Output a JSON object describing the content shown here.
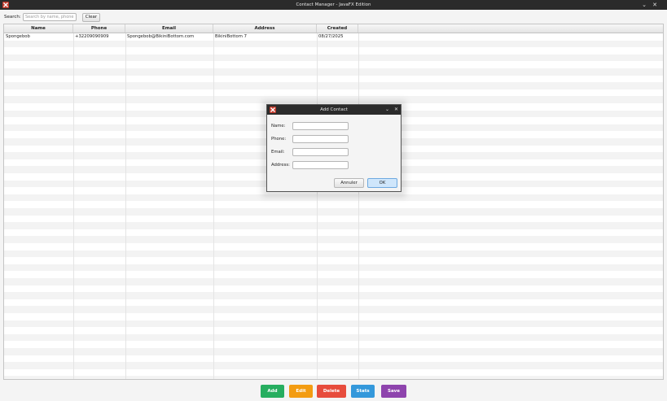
{
  "window": {
    "title": "Contact Manager - JavaFX Edition",
    "minimize_icon": "chevron-down-icon",
    "close_icon": "close-icon"
  },
  "search": {
    "label": "Search:",
    "placeholder": "Search by name, phone...",
    "value": "",
    "clear_label": "Clear"
  },
  "table": {
    "columns": [
      "Name",
      "Phone",
      "Email",
      "Address",
      "Created"
    ],
    "rows": [
      [
        "Spongebob",
        "+32209090909",
        "Spongebob@BikiniBottom.com",
        "BikiniBottom 7",
        "08/27/2025"
      ]
    ]
  },
  "actions": [
    {
      "label": "Add",
      "color": "#27ae60"
    },
    {
      "label": "Edit",
      "color": "#f39c12"
    },
    {
      "label": "Delete",
      "color": "#e74c3c"
    },
    {
      "label": "Stats",
      "color": "#3498db"
    },
    {
      "label": "Save",
      "color": "#8e44ad"
    }
  ],
  "dialog": {
    "title": "Add Contact",
    "fields": [
      {
        "label": "Name:",
        "value": ""
      },
      {
        "label": "Phone:",
        "value": ""
      },
      {
        "label": "Email:",
        "value": ""
      },
      {
        "label": "Address:",
        "value": ""
      }
    ],
    "cancel_label": "Annuler",
    "ok_label": "OK",
    "ok_color": "#cfe6fb"
  },
  "colors": {
    "titlebar": "#2b2b2b",
    "app_icon": "#e74c3c"
  }
}
